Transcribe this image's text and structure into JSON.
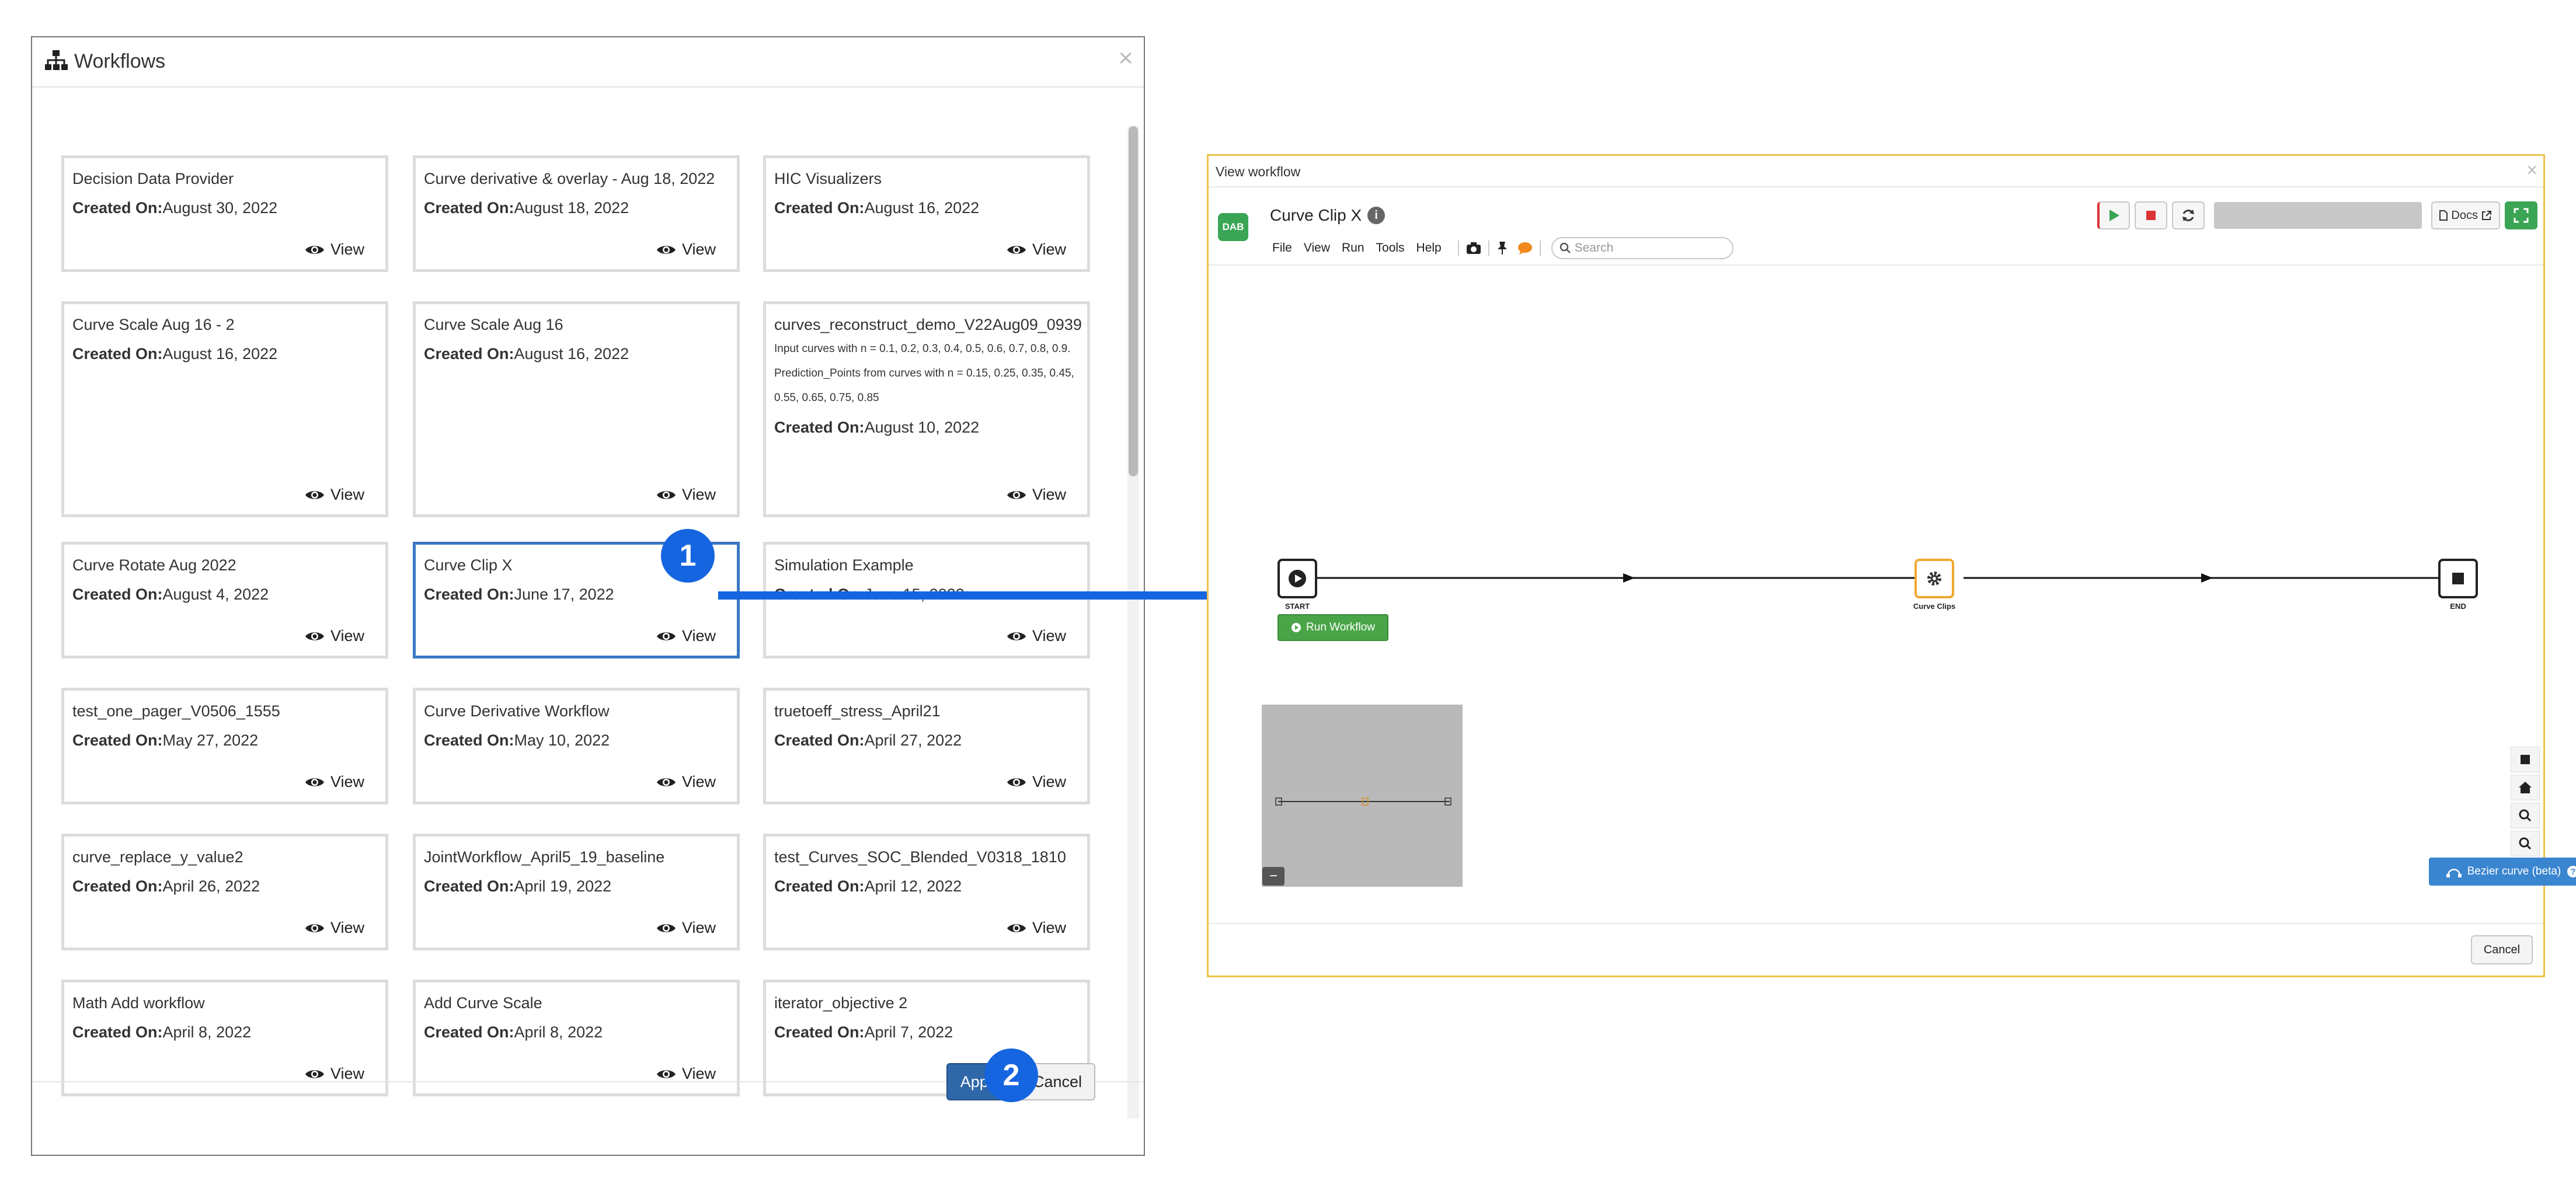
{
  "workflows_modal": {
    "title": "Workflows",
    "created_label": "Created On:",
    "view_label": "View",
    "cards": [
      {
        "title": "Decision Data Provider",
        "date": "August 30, 2022"
      },
      {
        "title": "Curve derivative & overlay - Aug 18, 2022",
        "date": "August 18, 2022"
      },
      {
        "title": "HIC Visualizers",
        "date": "August 16, 2022"
      },
      {
        "title": "Curve Scale Aug 16 - 2",
        "date": "August 16, 2022"
      },
      {
        "title": "Curve Scale Aug 16",
        "date": "August 16, 2022"
      },
      {
        "title": "curves_reconstruct_demo_V22Aug09_0939",
        "description": "Input curves with n = 0.1, 0.2, 0.3, 0.4, 0.5, 0.6, 0.7, 0.8, 0.9. Prediction_Points from curves with n = 0.15, 0.25, 0.35, 0.45, 0.55, 0.65, 0.75, 0.85",
        "date": "August 10, 2022"
      },
      {
        "title": "Curve Rotate Aug 2022",
        "date": "August 4, 2022"
      },
      {
        "title": "Curve Clip X",
        "date": "June 17, 2022",
        "selected": true
      },
      {
        "title": "Simulation Example",
        "date": "June 15, 2022"
      },
      {
        "title": "test_one_pager_V0506_1555",
        "date": "May 27, 2022"
      },
      {
        "title": "Curve Derivative Workflow",
        "date": "May 10, 2022"
      },
      {
        "title": "truetoeff_stress_April21",
        "date": "April 27, 2022"
      },
      {
        "title": "curve_replace_y_value2",
        "date": "April 26, 2022"
      },
      {
        "title": "JointWorkflow_April5_19_baseline",
        "date": "April 19, 2022"
      },
      {
        "title": "test_Curves_SOC_Blended_V0318_1810",
        "date": "April 12, 2022"
      },
      {
        "title": "Math Add workflow",
        "date": "April 8, 2022"
      },
      {
        "title": "Add Curve Scale",
        "date": "April 8, 2022"
      },
      {
        "title": "iterator_objective 2",
        "date": "April 7, 2022"
      }
    ],
    "apply_label": "Apply",
    "cancel_label": "Cancel"
  },
  "badges": {
    "one": "1",
    "two": "2"
  },
  "view_workflow": {
    "title": "View workflow",
    "workflow_name": "Curve Clip X",
    "logo_text": "DAB",
    "menu": [
      "File",
      "View",
      "Run",
      "Tools",
      "Help"
    ],
    "search_placeholder": "Search",
    "docs_label": "Docs",
    "nodes": {
      "start": "START",
      "middle": "Curve Clips",
      "end": "END"
    },
    "run_label": "Run Workflow",
    "bezier_label": "Bezier curve (beta)",
    "cancel_label": "Cancel"
  },
  "colors": {
    "accent_blue": "#1565e0",
    "selected_border": "#3a78c2",
    "apply_blue": "#2f68a8",
    "green": "#3aa655",
    "orange": "#f0a830",
    "frame_yellow": "#f0c24a"
  }
}
